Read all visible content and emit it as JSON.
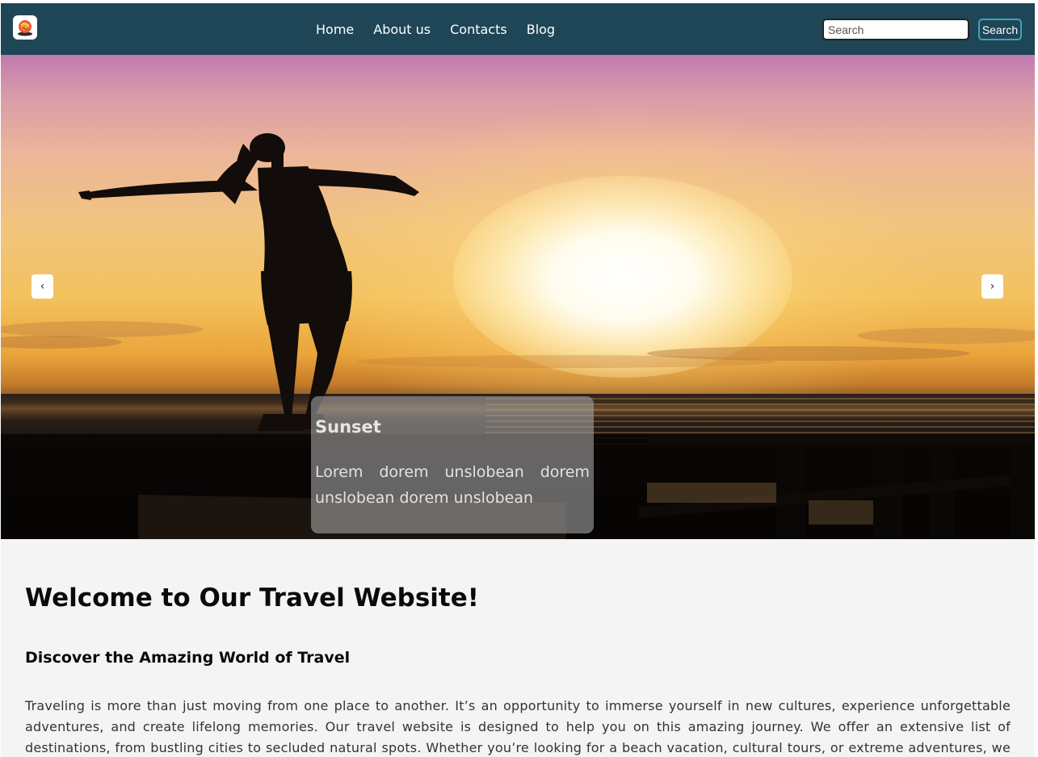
{
  "navbar": {
    "logo_icon": "travel-globe-logo-icon",
    "links": [
      {
        "label": "Home"
      },
      {
        "label": "About us"
      },
      {
        "label": "Contacts"
      },
      {
        "label": "Blog"
      }
    ],
    "search": {
      "placeholder": "Search",
      "value": "",
      "button_label": "Search"
    },
    "colors": {
      "background": "#1e4657",
      "search_button_border": "#3aa6b0"
    }
  },
  "hero": {
    "image_alt": "Silhouette of a woman with outstretched arms on a pier at sunset",
    "prev_icon": "chevron-left-icon",
    "next_icon": "chevron-right-icon",
    "prev_label": "‹",
    "next_label": "›",
    "caption": {
      "title": "Sunset",
      "text": "Lorem dorem unslobean dorem unslobean dorem unslobean"
    }
  },
  "content": {
    "heading": "Welcome to Our Travel Website!",
    "subheading": "Discover the Amazing World of Travel",
    "paragraph": "Traveling is more than just moving from one place to another. It’s an opportunity to immerse yourself in new cultures, experience unforgettable adventures, and create lifelong memories. Our travel website is designed to help you on this amazing journey. We offer an extensive list of destinations, from bustling cities to secluded natural spots. Whether you’re looking for a beach vacation, cultural tours, or extreme adventures, we have something for"
  }
}
